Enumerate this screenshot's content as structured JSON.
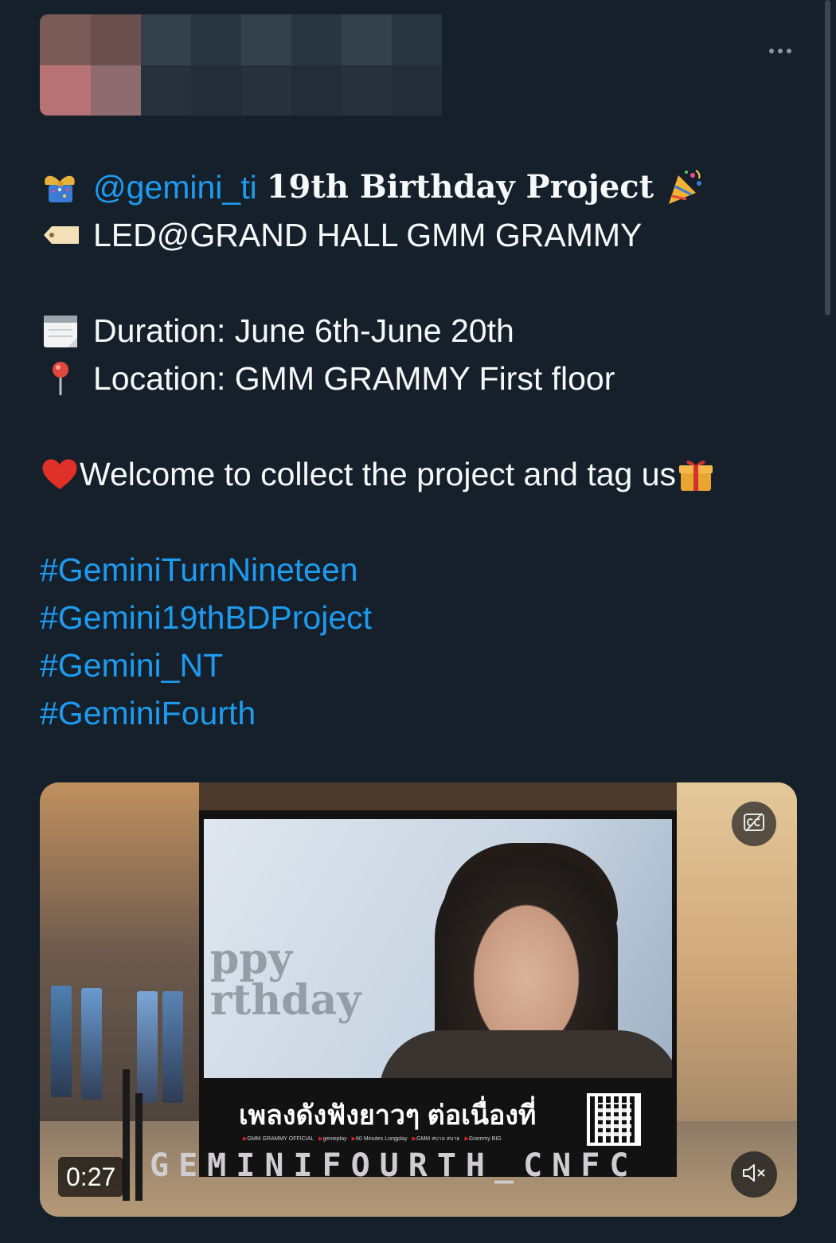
{
  "tweet": {
    "mention": "@gemini_ti",
    "title_rest": "19th Birthday Project",
    "venue": "LED@GRAND HALL GMM GRAMMY",
    "duration": "Duration: June 6th-June 20th",
    "location": "Location: GMM GRAMMY First floor",
    "welcome": "Welcome to collect the project and tag us",
    "hashtags": [
      "#GeminiTurnNineteen",
      "#Gemini19thBDProject",
      "#Gemini_NT",
      "#GeminiFourth"
    ],
    "icons": [
      "ribbon-gift-icon",
      "party-popper-icon",
      "label-tag-icon",
      "calendar-icon",
      "pin-icon",
      "red-heart-icon",
      "wrapped-gift-icon"
    ]
  },
  "video": {
    "screen_text_1": "ppy",
    "screen_text_2": "rthday",
    "ticker_thai": "เพลงดังฟังยาวๆ ต่อเนื่องที่",
    "ticker_sources": [
      "GMM GRAMMY OFFICIAL",
      "genieplay",
      "60 Minutes Longplay",
      "GMM สบาย สบาย",
      "Grammy BIG"
    ],
    "fanclub": "GEMINIFOURTH_CNFC",
    "timestamp": "0:27",
    "colors": {
      "link": "#1d9bf0",
      "background": "#15202b"
    }
  }
}
